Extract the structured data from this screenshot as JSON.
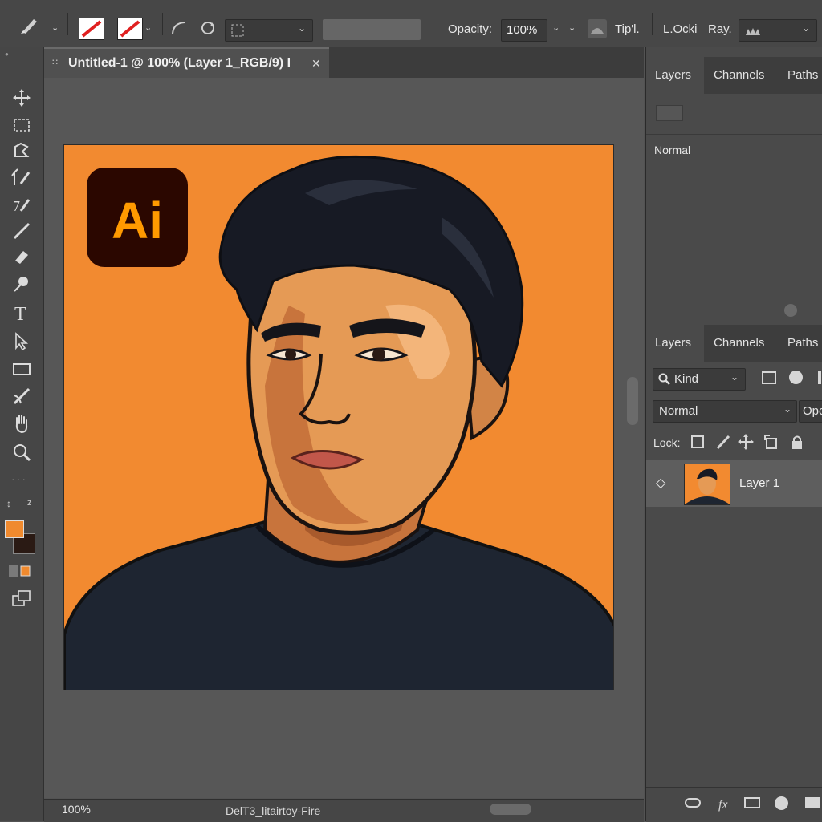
{
  "options_bar": {
    "opacity_label": "Opacity:",
    "opacity_value": "100%",
    "tip_label": "Tip'l.",
    "lock_label": "L.Ocki",
    "ray_label": "Ray."
  },
  "document": {
    "tab_title": "Untitled-1 @ 100% (Layer 1_RGB/9) I",
    "close_glyph": "✕"
  },
  "artwork": {
    "logo_text": "Ai"
  },
  "status_bar": {
    "zoom": "100%",
    "info": "DelT3_litairtoy-Fire"
  },
  "panel_top": {
    "tabs": [
      "Layers",
      "Channels",
      "Paths"
    ],
    "blend_mode": "Normal"
  },
  "panel_bottom": {
    "tabs": [
      "Layers",
      "Channels",
      "Paths"
    ],
    "filter_kind": "Kind",
    "blend_mode": "Normal",
    "opacity_short": "Ope",
    "lock_label": "Lock:",
    "layers": [
      {
        "name": "Layer 1"
      }
    ]
  },
  "colors": {
    "foreground": "#f08a2e",
    "background": "#2a1a14",
    "artboard": "#f28a30"
  }
}
